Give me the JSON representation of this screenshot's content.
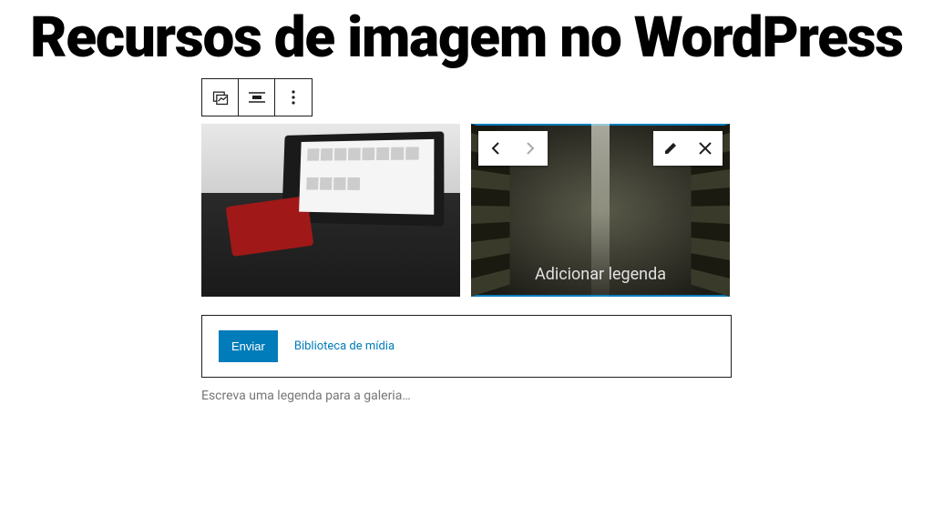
{
  "title": "Recursos de imagem no WordPress",
  "toolbar": {
    "block_type": "gallery",
    "align": "center",
    "more": "more"
  },
  "gallery": {
    "items": [
      {
        "alt": "image-laptop-card",
        "selected": false
      },
      {
        "alt": "image-warehouse",
        "selected": true,
        "caption_placeholder": "Adicionar legenda"
      }
    ]
  },
  "item_controls": {
    "prev": "move-left",
    "next": "move-right",
    "edit": "edit",
    "remove": "remove"
  },
  "uploader": {
    "upload_label": "Enviar",
    "media_library_label": "Biblioteca de mídia"
  },
  "gallery_caption_placeholder": "Escreva uma legenda para a galeria…"
}
